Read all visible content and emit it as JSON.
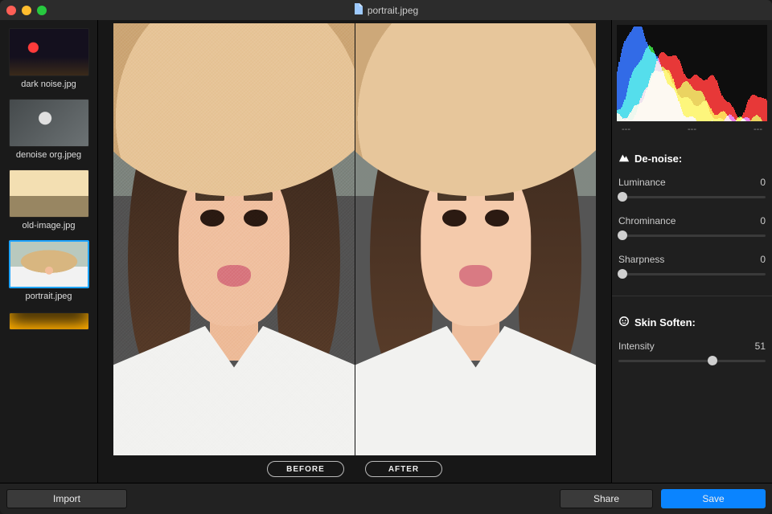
{
  "window_title": "portrait.jpeg",
  "sidebar": {
    "thumbs": [
      {
        "label": "dark noise.jpg"
      },
      {
        "label": "denoise org.jpeg"
      },
      {
        "label": "old-image.jpg"
      },
      {
        "label": "portrait.jpeg"
      }
    ],
    "active_index": 3
  },
  "preview": {
    "before_label": "BEFORE",
    "after_label": "AFTER"
  },
  "histogram_stats": {
    "a": "---",
    "b": "---",
    "c": "---"
  },
  "denoise": {
    "heading": "De-noise:",
    "luminance": {
      "label": "Luminance",
      "value": 0
    },
    "chrominance": {
      "label": "Chrominance",
      "value": 0
    },
    "sharpness": {
      "label": "Sharpness",
      "value": 0
    }
  },
  "skin": {
    "heading": "Skin Soften:",
    "intensity": {
      "label": "Intensity",
      "value": 51
    }
  },
  "buttons": {
    "import": "Import",
    "share": "Share",
    "save": "Save"
  }
}
